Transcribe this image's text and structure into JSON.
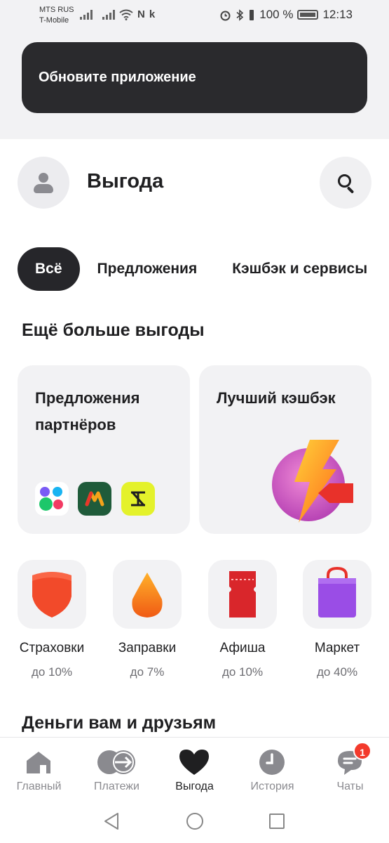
{
  "status_bar": {
    "carrier_1": "MTS RUS",
    "carrier_2": "T-Mobile",
    "battery": "100 %",
    "time": "12:13"
  },
  "banner": {
    "text": "Обновите приложение"
  },
  "header": {
    "title": "Выгода"
  },
  "tabs": [
    {
      "label": "Всё",
      "active": true
    },
    {
      "label": "Предложения",
      "active": false
    },
    {
      "label": "Кэшбэк и сервисы",
      "active": false
    }
  ],
  "section_1": {
    "title": "Ещё больше выгоды"
  },
  "cards": [
    {
      "title": "Предложения партнёров"
    },
    {
      "title": "Лучший кэшбэк"
    }
  ],
  "categories": [
    {
      "label": "Страховки",
      "sub": "до 10%",
      "icon": "shield-icon",
      "color": "#f24a2a"
    },
    {
      "label": "Заправки",
      "sub": "до 7%",
      "icon": "fuel-drop-icon",
      "color": "#f5741f"
    },
    {
      "label": "Афиша",
      "sub": "до 10%",
      "icon": "ticket-icon",
      "color": "#d9262b"
    },
    {
      "label": "Маркет",
      "sub": "до 40%",
      "icon": "shopping-bag-icon",
      "color": "#9a4de6"
    }
  ],
  "section_2": {
    "title": "Деньги вам и друзьям"
  },
  "bottom_nav": [
    {
      "label": "Главный",
      "icon": "home-icon",
      "active": false
    },
    {
      "label": "Платежи",
      "icon": "payments-icon",
      "active": false
    },
    {
      "label": "Выгода",
      "icon": "heart-icon",
      "active": true
    },
    {
      "label": "История",
      "icon": "clock-icon",
      "active": false
    },
    {
      "label": "Чаты",
      "icon": "chat-icon",
      "active": false,
      "badge": "1"
    }
  ],
  "colors": {
    "accent_dark": "#26262a",
    "surface": "#f2f2f4",
    "badge_red": "#f33a2c"
  }
}
